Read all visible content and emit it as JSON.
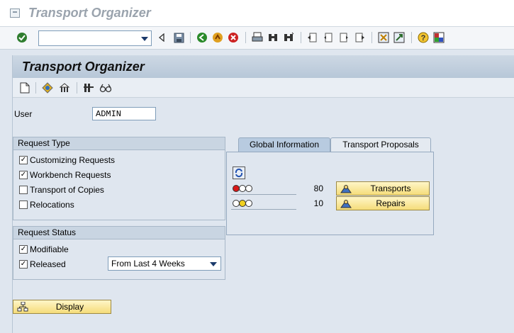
{
  "window": {
    "title": "Transport Organizer"
  },
  "toolbar": {
    "command_field_value": "",
    "icons": [
      "enter-icon",
      "back-nav-icon",
      "save-icon",
      "back-icon",
      "exit-icon",
      "cancel-icon",
      "print-icon",
      "find-icon",
      "find-next-icon",
      "first-page-icon",
      "previous-page-icon",
      "next-page-icon",
      "last-page-icon",
      "create-session-icon",
      "shortcut-icon",
      "help-icon",
      "layout-icon"
    ]
  },
  "screen": {
    "title": "Transport Organizer"
  },
  "app_toolbar": {
    "icons": [
      "create-request-icon",
      "display-object-icon",
      "transport-routes-icon",
      "tools-icon",
      "glasses-icon"
    ]
  },
  "user": {
    "label": "User",
    "value": "ADMIN"
  },
  "request_type": {
    "title": "Request Type",
    "options": [
      {
        "label": "Customizing Requests",
        "checked": true
      },
      {
        "label": "Workbench Requests",
        "checked": true
      },
      {
        "label": "Transport of Copies",
        "checked": false
      },
      {
        "label": "Relocations",
        "checked": false
      }
    ]
  },
  "request_status": {
    "title": "Request Status",
    "modifiable": {
      "label": "Modifiable",
      "checked": true
    },
    "released": {
      "label": "Released",
      "checked": true
    },
    "period": {
      "selected": "From Last 4 Weeks"
    }
  },
  "tabs": [
    {
      "label": "Global Information",
      "active": true
    },
    {
      "label": "Transport Proposals",
      "active": false
    }
  ],
  "global_info": {
    "rows": [
      {
        "status": "red",
        "count": "80",
        "button": "Transports"
      },
      {
        "status": "yellow",
        "count": "10",
        "button": "Repairs"
      }
    ]
  },
  "display_button": {
    "label": "Display"
  },
  "colors": {
    "accent_yellow": "#f5dc7a",
    "panel_bg": "#dfe6ef",
    "header_blue": "#b7c7d8"
  }
}
